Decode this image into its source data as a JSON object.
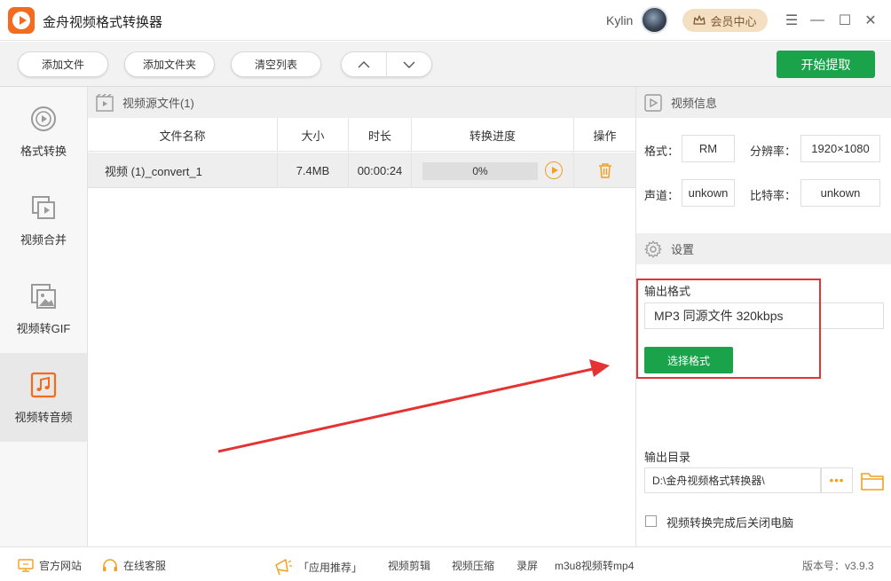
{
  "app": {
    "title": "金舟视频格式转换器",
    "user_name": "Kylin",
    "vip_label": "会员中心"
  },
  "window_controls": {
    "menu": "☰",
    "minimize": "—",
    "maximize": "☐",
    "close": "✕"
  },
  "toolbar": {
    "add_file": "添加文件",
    "add_folder": "添加文件夹",
    "clear_list": "清空列表",
    "move_up": "︿",
    "move_down": "﹀",
    "start": "开始提取"
  },
  "sidebar": {
    "items": [
      {
        "label": "格式转换",
        "icon": "play-circle-icon"
      },
      {
        "label": "视频合并",
        "icon": "merge-video-icon"
      },
      {
        "label": "视频转GIF",
        "icon": "image-icon"
      },
      {
        "label": "视频转音频",
        "icon": "music-note-icon",
        "active": true
      }
    ]
  },
  "file_panel": {
    "header": "视频源文件(1)",
    "columns": [
      "文件名称",
      "大小",
      "时长",
      "转换进度",
      "操作"
    ],
    "rows": [
      {
        "name": "视频 (1)_convert_1",
        "size": "7.4MB",
        "duration": "00:00:24",
        "progress": "0%",
        "progress_value": 0
      }
    ]
  },
  "video_info": {
    "header": "视频信息",
    "format_label": "格式：",
    "format_value": "RM",
    "resolution_label": "分辨率：",
    "resolution_value": "1920×1080",
    "channel_label": "声道：",
    "channel_value": "unkown",
    "bitrate_label": "比特率：",
    "bitrate_value": "unkown"
  },
  "settings": {
    "header": "设置",
    "output_format_label": "输出格式",
    "output_format_value": "MP3 同源文件 320kbps",
    "choose_format": "选择格式",
    "output_dir_label": "输出目录",
    "output_dir_value": "D:\\金舟视频格式转换器\\",
    "more": "•••",
    "shutdown_label": "视频转换完成后关闭电脑",
    "shutdown_checked": false
  },
  "statusbar": {
    "website": "官方网站",
    "support": "在线客服",
    "recommend": "「应用推荐」",
    "links": [
      "视频剪辑",
      "视频压缩",
      "录屏",
      "m3u8视频转mp4"
    ],
    "version": "版本号：v3.9.3"
  },
  "colors": {
    "accent_green": "#1aa34a",
    "brand_orange": "#f26b1f",
    "annotation_red": "#e53333",
    "icon_orange": "#f2a022"
  }
}
